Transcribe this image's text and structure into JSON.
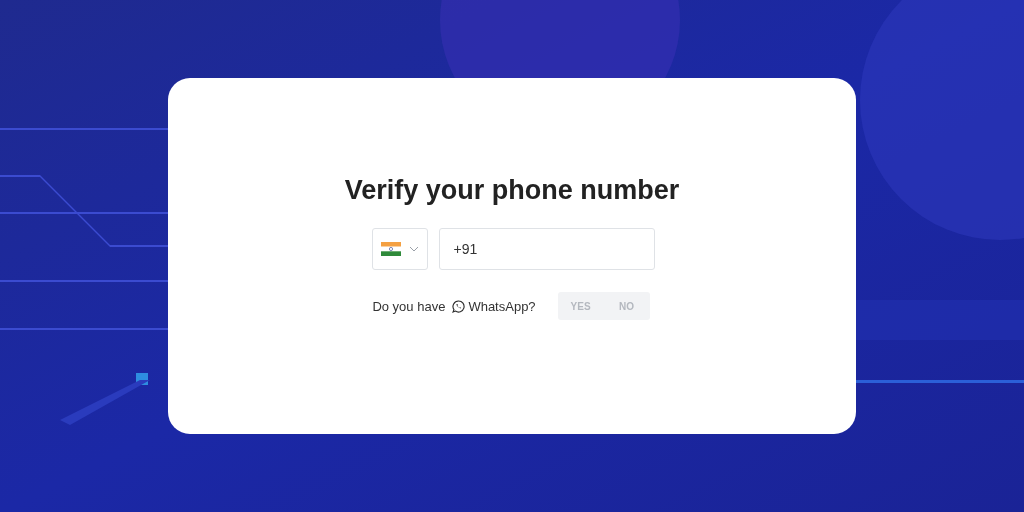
{
  "dialog": {
    "title": "Verify your phone number",
    "country_select": {
      "expanded": false
    },
    "phone_field": {
      "value": "+91"
    },
    "whatsapp_prompt": {
      "label_before": "Do you have",
      "label_app": "WhatsApp?"
    },
    "whatsapp_options": [
      {
        "label": "YES",
        "selected": false
      },
      {
        "label": "NO",
        "selected": false
      }
    ]
  }
}
